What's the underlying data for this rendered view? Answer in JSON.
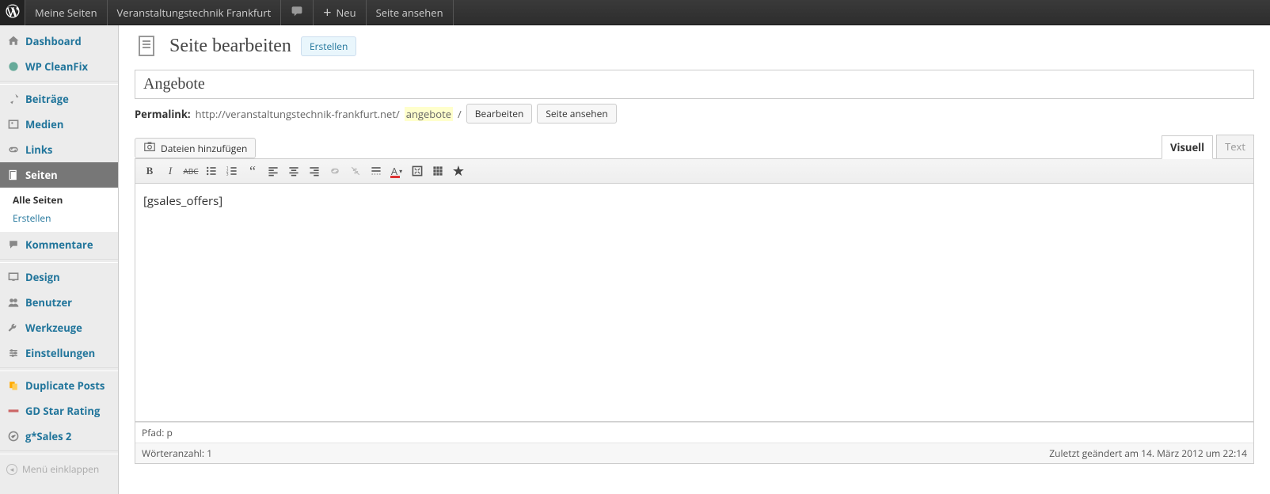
{
  "adminbar": {
    "my_sites": "Meine Seiten",
    "site_name": "Veranstaltungstechnik Frankfurt",
    "new": "Neu",
    "view_page": "Seite ansehen"
  },
  "sidebar": {
    "dashboard": "Dashboard",
    "cleanfix": "WP CleanFix",
    "posts": "Beiträge",
    "media": "Medien",
    "links": "Links",
    "pages": "Seiten",
    "pages_sub_all": "Alle Seiten",
    "pages_sub_new": "Erstellen",
    "comments": "Kommentare",
    "appearance": "Design",
    "users": "Benutzer",
    "tools": "Werkzeuge",
    "settings": "Einstellungen",
    "duplicate": "Duplicate Posts",
    "gdstar": "GD Star Rating",
    "gsales": "g*Sales 2",
    "collapse": "Menü einklappen"
  },
  "page": {
    "heading": "Seite bearbeiten",
    "add_new": "Erstellen",
    "title_value": "Angebote",
    "permalink_label": "Permalink:",
    "permalink_base": "http://veranstaltungstechnik-frankfurt.net/",
    "permalink_slug": "angebote",
    "permalink_trail": "/",
    "edit_btn": "Bearbeiten",
    "view_btn": "Seite ansehen",
    "add_media": "Dateien hinzufügen",
    "tab_visual": "Visuell",
    "tab_text": "Text",
    "editor_content": "[gsales_offers]",
    "path_label": "Pfad: ",
    "path_value": "p",
    "wordcount_label": "Wörteranzahl: ",
    "wordcount_value": "1",
    "last_edited": "Zuletzt geändert am 14. März 2012 um 22:14"
  }
}
